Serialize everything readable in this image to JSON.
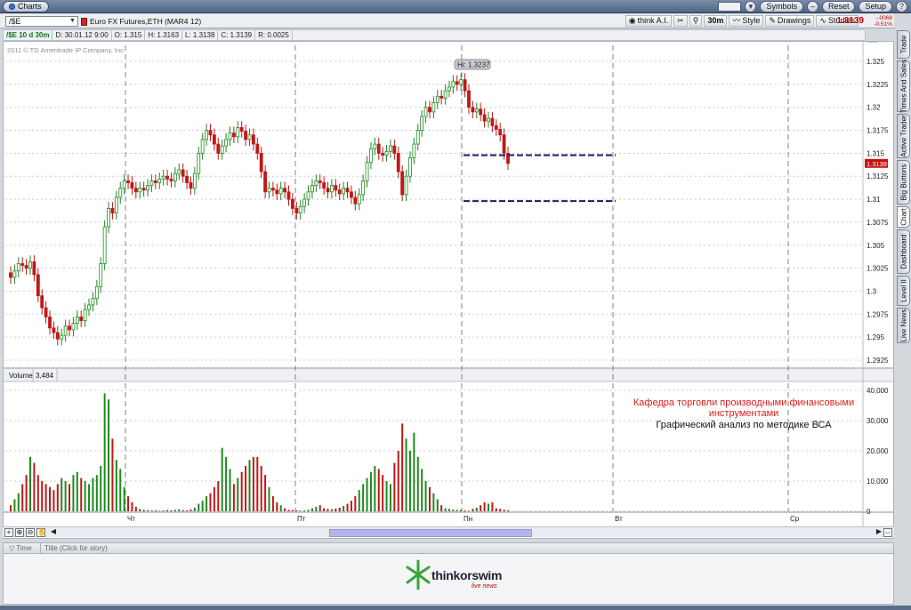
{
  "window": {
    "tab_label": "Charts"
  },
  "title_buttons": {
    "symbols": "Symbols",
    "reset": "Reset",
    "setup": "Setup"
  },
  "toolbar": {
    "symbol_value": "/$E",
    "instrument": "Euro FX Futures,ETH (MAR4 12)",
    "think_ai": "think A.I.",
    "timeframe": "30m",
    "style": "Style",
    "drawings": "Drawings",
    "studies": "Studies",
    "last_price": "1.3139",
    "net_change_top": "-.0068",
    "net_change_pct": "-0.51%"
  },
  "info": {
    "symbol": "/$E 10 d 30m",
    "date": "D: 30.01.12 9:00",
    "open": "O: 1.315",
    "high": "H: 1.3163",
    "low": "L: 1.3138",
    "close": "C: 1.3139",
    "range": "R: 0.0025"
  },
  "chart": {
    "copyright": "2011 © TD Ameritrade IP Company, Inc.",
    "hi_label": "Hi: 1.3237",
    "price_marker": "1.3139",
    "volume_label": "Volume",
    "volume_value": "3,484",
    "annotation_line1": "Кафедра торговли производными финансовыми",
    "annotation_line2": "инструментами",
    "annotation_line3": "Графический анализ по методике ВСА",
    "annotation_color": "#e02020"
  },
  "chart_data": {
    "type": "candlestick",
    "price_axis": {
      "min": 1.2925,
      "max": 1.325,
      "ticks": [
        "1.325",
        "1.3225",
        "1.32",
        "1.3175",
        "1.315",
        "1.3125",
        "1.31",
        "1.3075",
        "1.305",
        "1.3025",
        "1.3",
        "1.2975",
        "1.295",
        "1.2925"
      ]
    },
    "volume_axis": {
      "min": 0,
      "max": 40000,
      "ticks": [
        "40,000",
        "30,000",
        "20,000",
        "10,000",
        "0"
      ]
    },
    "x_ticks": [
      "Чт",
      "Пт",
      "Пн",
      "Вт",
      "Ср"
    ],
    "up_color": "#1f8a1f",
    "down_color": "#c01818",
    "support_lines": [
      1.3148,
      1.3098
    ],
    "closes": [
      1.3015,
      1.3022,
      1.303,
      1.3028,
      1.3025,
      1.3032,
      1.3018,
      1.2995,
      1.2982,
      1.2972,
      1.296,
      1.2955,
      1.2948,
      1.2952,
      1.2962,
      1.2958,
      1.2965,
      1.2972,
      1.2968,
      1.298,
      1.2985,
      1.2992,
      1.3005,
      1.303,
      1.307,
      1.309,
      1.3085,
      1.3102,
      1.3112,
      1.312,
      1.3118,
      1.3112,
      1.3108,
      1.3112,
      1.311,
      1.3115,
      1.312,
      1.3118,
      1.3122,
      1.3125,
      1.3122,
      1.312,
      1.3128,
      1.3132,
      1.3125,
      1.3118,
      1.3112,
      1.3128,
      1.315,
      1.3165,
      1.3175,
      1.317,
      1.316,
      1.315,
      1.3158,
      1.3165,
      1.3172,
      1.3168,
      1.3178,
      1.3174,
      1.3165,
      1.317,
      1.316,
      1.315,
      1.313,
      1.3108,
      1.3112,
      1.311,
      1.3106,
      1.3112,
      1.3108,
      1.31,
      1.309,
      1.3085,
      1.3092,
      1.31,
      1.3108,
      1.3115,
      1.312,
      1.3118,
      1.3112,
      1.3108,
      1.3115,
      1.311,
      1.3106,
      1.3112,
      1.3108,
      1.3102,
      1.3095,
      1.3105,
      1.312,
      1.314,
      1.3155,
      1.316,
      1.315,
      1.3148,
      1.3152,
      1.3158,
      1.315,
      1.313,
      1.3105,
      1.3125,
      1.3145,
      1.316,
      1.3175,
      1.319,
      1.32,
      1.3195,
      1.3205,
      1.3212,
      1.321,
      1.3218,
      1.3222,
      1.3228,
      1.3225,
      1.323,
      1.3218,
      1.32,
      1.3195,
      1.3198,
      1.3192,
      1.3185,
      1.3188,
      1.318,
      1.3176,
      1.317,
      1.315,
      1.3139
    ],
    "volumes": [
      2000,
      4000,
      6000,
      9000,
      12000,
      18000,
      16000,
      12000,
      10000,
      9000,
      8000,
      7000,
      9000,
      11000,
      10000,
      9000,
      12000,
      13000,
      11000,
      10000,
      9000,
      11000,
      12000,
      15000,
      39000,
      37000,
      24000,
      17000,
      14000,
      8000,
      5000,
      3000,
      1500,
      800,
      500,
      400,
      300,
      300,
      200,
      300,
      400,
      300,
      500,
      700,
      400,
      300,
      600,
      1200,
      2500,
      3500,
      5000,
      6000,
      8000,
      10000,
      21000,
      18000,
      14000,
      9000,
      11000,
      13000,
      15000,
      17000,
      18000,
      18000,
      15000,
      12000,
      8000,
      5000,
      3000,
      2000,
      1000,
      500,
      400,
      300,
      200,
      300,
      500,
      1000,
      1500,
      2000,
      1000,
      800,
      700,
      900,
      1200,
      1800,
      2500,
      3500,
      5000,
      7000,
      9000,
      11000,
      13000,
      15000,
      14000,
      12000,
      10000,
      9000,
      16000,
      20000,
      29000,
      24000,
      20000,
      26000,
      18000,
      14000,
      10000,
      8000,
      6000,
      4000,
      2000,
      1000,
      800,
      600,
      400,
      500,
      300,
      200,
      800,
      1200,
      2000,
      3000,
      2500,
      3000,
      1000,
      800,
      500,
      300,
      300
    ]
  },
  "bottom": {
    "news_time_col": "Time",
    "news_title_col": "Title (Click for story)"
  },
  "logo": {
    "name": "thinkorswim",
    "sub": "live news"
  },
  "side_tabs": [
    "Trade",
    "Times And Sales",
    "Active Trader",
    "Big Buttons",
    "Chart",
    "Dashboard",
    "Level II",
    "Live News"
  ]
}
